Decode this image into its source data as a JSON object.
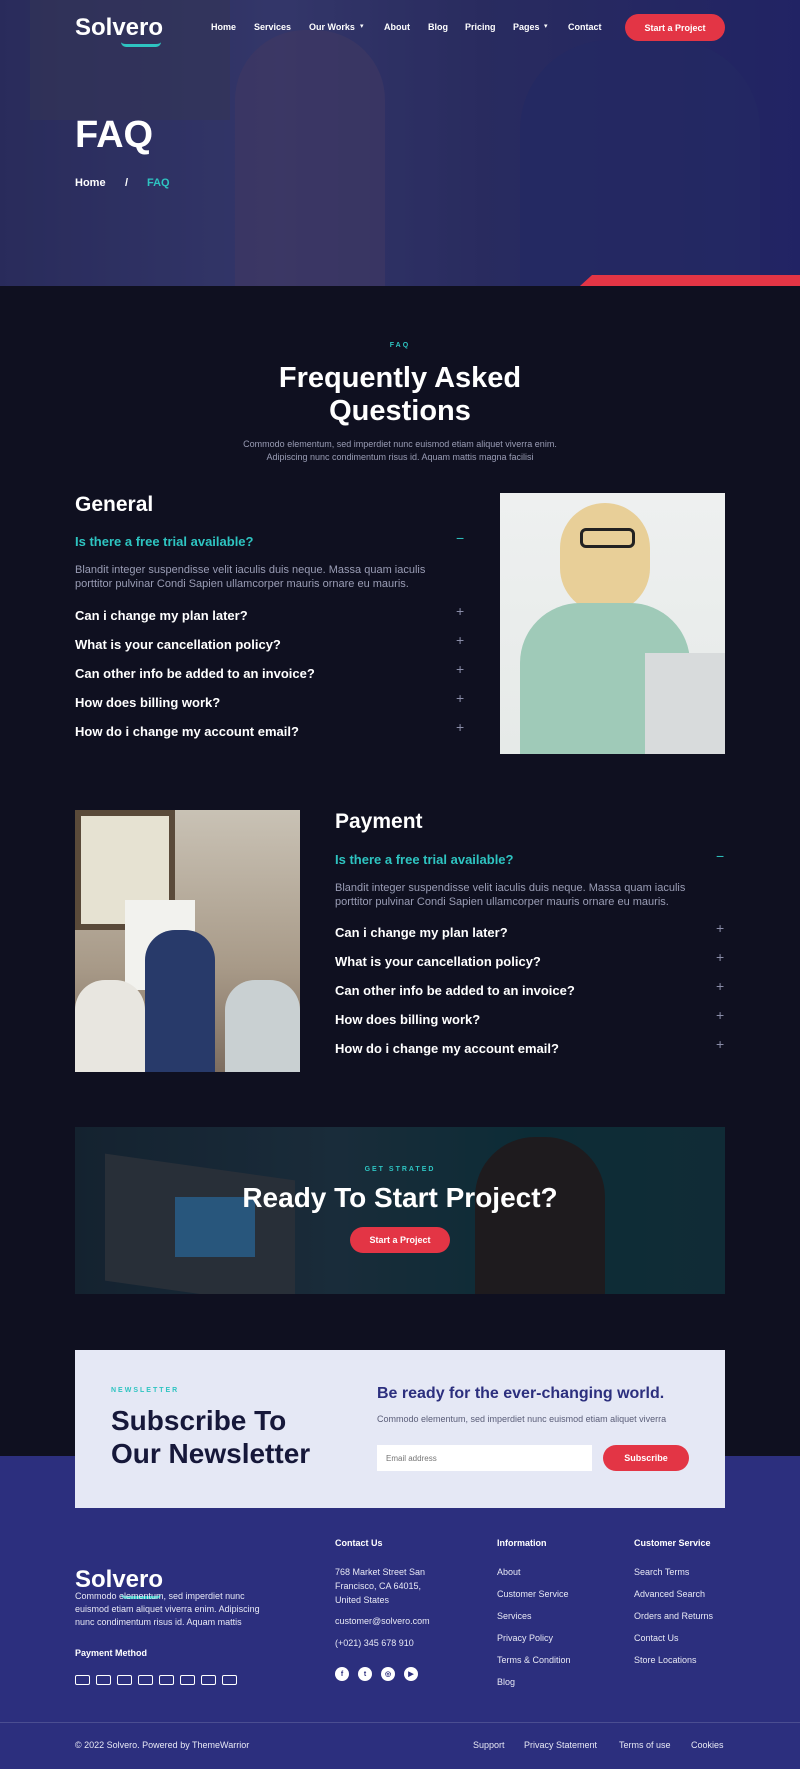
{
  "brand": {
    "name": "Solvero"
  },
  "nav": {
    "items": [
      "Home",
      "Services",
      "Our Works",
      "About",
      "Blog",
      "Pricing",
      "Pages",
      "Contact"
    ],
    "cta": "Start a Project"
  },
  "hero": {
    "title": "FAQ",
    "crumb_home": "Home",
    "crumb_sep": "/",
    "crumb_current": "FAQ"
  },
  "faq_section": {
    "tag": "FAQ",
    "title_1": "Frequently Asked",
    "title_2": "Questions",
    "desc_1": "Commodo elementum, sed imperdiet nunc euismod etiam aliquet viverra enim.",
    "desc_2": "Adipiscing nunc condimentum risus id. Aquam mattis magna facilisi"
  },
  "general": {
    "title": "General",
    "active_q": "Is there a free trial available?",
    "answer_1": "Blandit integer suspendisse velit iaculis duis neque. Massa quam iaculis",
    "answer_2": "porttitor pulvinar Condi Sapien ullamcorper mauris ornare eu mauris.",
    "questions": [
      "Can i change my plan later?",
      "What is your cancellation policy?",
      "Can other info be added to an invoice?",
      "How does billing work?",
      "How do i change my account email?"
    ],
    "minus": "−",
    "plus": "+"
  },
  "payment": {
    "title": "Payment",
    "active_q": "Is there a free trial available?",
    "answer_1": "Blandit integer suspendisse velit iaculis duis neque. Massa quam iaculis",
    "answer_2": "porttitor pulvinar Condi Sapien ullamcorper mauris ornare eu mauris.",
    "questions": [
      "Can i change my plan later?",
      "What is your cancellation policy?",
      "Can other info be added to an invoice?",
      "How does billing work?",
      "How do i change my account email?"
    ],
    "minus": "−",
    "plus": "+"
  },
  "cta": {
    "tag": "GET STRATED",
    "title": "Ready To Start Project?",
    "button": "Start a Project"
  },
  "newsletter": {
    "tag": "NEWSLETTER",
    "title_1": "Subscribe To",
    "title_2": "Our Newsletter",
    "right_title": "Be ready for the ever-changing world.",
    "right_desc": "Commodo elementum, sed imperdiet nunc euismod etiam aliquet viverra",
    "placeholder": "Email address",
    "button": "Subscribe"
  },
  "footer": {
    "desc_1": "Commodo elementum, sed imperdiet nunc",
    "desc_2": "euismod etiam aliquet viverra enim. Adipiscing",
    "desc_3": "nunc condimentum risus id. Aquam mattis",
    "payment_label": "Payment Method",
    "contact": {
      "title": "Contact Us",
      "addr_1": "768 Market Street San",
      "addr_2": "Francisco, CA 64015,",
      "addr_3": "United States",
      "email": "customer@solvero.com",
      "phone": "(+021) 345 678 910"
    },
    "info": {
      "title": "Information",
      "links": [
        "About",
        "Customer Service",
        "Services",
        "Privacy Policy",
        "Terms & Condition",
        "Blog"
      ]
    },
    "service": {
      "title": "Customer Service",
      "links": [
        "Search Terms",
        "Advanced Search",
        "Orders and Returns",
        "Contact Us",
        "Store Locations"
      ]
    },
    "copyright": "© 2022 Solvero. Powered by ThemeWarrior",
    "bottom_links": [
      "Support",
      "Privacy Statement",
      "Terms of use",
      "Cookies"
    ]
  },
  "colors": {
    "accent": "#2ec4c1",
    "red": "#e33545",
    "footer": "#2c2f7e",
    "dark": "#0f1020"
  }
}
